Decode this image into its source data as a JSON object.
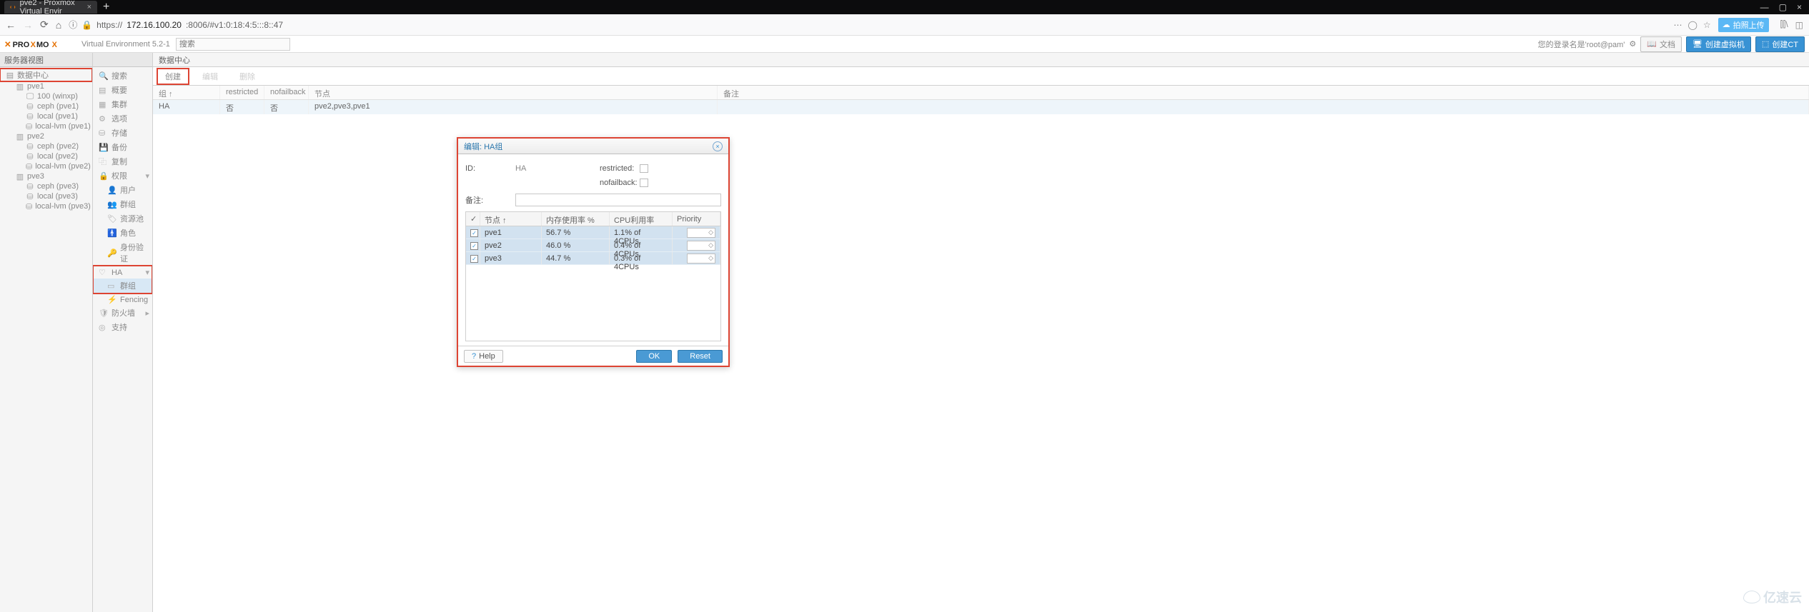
{
  "browser": {
    "tab_title": "pve2 - Proxmox Virtual Envir",
    "url_prefix": "https://",
    "url_host": "172.16.100.20",
    "url_rest": ":8006/#v1:0:18:4:5:::8::47",
    "ext_badge": "拍照上传"
  },
  "proxmox": {
    "version": "Virtual Environment 5.2-1",
    "search_ph": "搜索",
    "login_text": "您的登录名是'root@pam'",
    "btn_docs": "文档",
    "btn_vm": "创建虚拟机",
    "btn_ct": "创建CT"
  },
  "tree": {
    "header": "服务器视图",
    "dc": "数据中心",
    "nodes": [
      {
        "name": "pve1",
        "children": [
          "100 (winxp)",
          "ceph (pve1)",
          "local (pve1)",
          "local-lvm (pve1)"
        ]
      },
      {
        "name": "pve2",
        "children": [
          "ceph (pve2)",
          "local (pve2)",
          "local-lvm (pve2)"
        ]
      },
      {
        "name": "pve3",
        "children": [
          "ceph (pve3)",
          "local (pve3)",
          "local-lvm (pve3)"
        ]
      }
    ]
  },
  "menu": {
    "search": "搜索",
    "summary": "概要",
    "cluster": "集群",
    "options": "选项",
    "storage": "存储",
    "backup": "备份",
    "replication": "复制",
    "permissions": "权限",
    "users": "用户",
    "groups": "群组",
    "pools": "资源池",
    "roles": "角色",
    "auth": "身份验证",
    "ha": "HA",
    "ha_groups": "群组",
    "fencing": "Fencing",
    "firewall": "防火墙",
    "support": "支持"
  },
  "content": {
    "breadcrumb": "数据中心",
    "btn_create": "创建",
    "btn_edit": "编辑",
    "btn_delete": "删除",
    "col_group": "组 ↑",
    "col_restricted": "restricted",
    "col_nofailback": "nofailback",
    "col_nodes": "节点",
    "col_comment": "备注",
    "row": {
      "group": "HA",
      "restricted": "否",
      "nofailback": "否",
      "nodes": "pve2,pve3,pve1",
      "comment": ""
    }
  },
  "dialog": {
    "title": "编辑: HA组",
    "id_label": "ID:",
    "id_value": "HA",
    "restricted_label": "restricted:",
    "nofailback_label": "nofailback:",
    "comment_label": "备注:",
    "col_node": "节点 ↑",
    "col_mem": "内存使用率 %",
    "col_cpu": "CPU利用率",
    "col_prio": "Priority",
    "rows": [
      {
        "node": "pve1",
        "mem": "56.7 %",
        "cpu": "1.1% of 4CPUs"
      },
      {
        "node": "pve2",
        "mem": "46.0 %",
        "cpu": "0.4% of 4CPUs"
      },
      {
        "node": "pve3",
        "mem": "44.7 %",
        "cpu": "0.3% of 4CPUs"
      }
    ],
    "help": "Help",
    "ok": "OK",
    "reset": "Reset"
  },
  "watermark": "亿速云"
}
